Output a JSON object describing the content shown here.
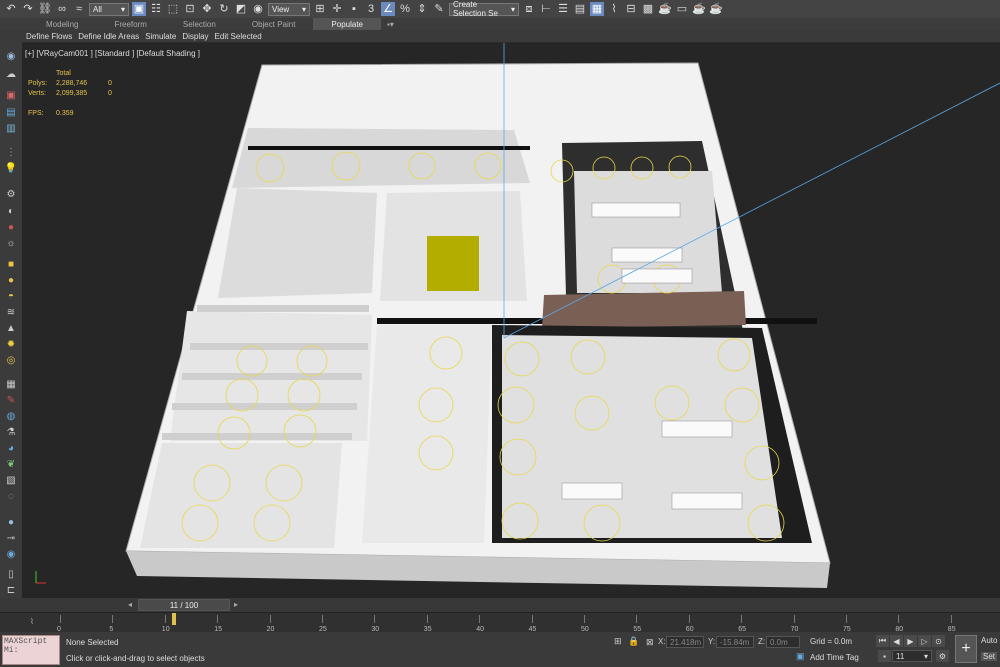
{
  "toolbar": {
    "filter_value": "All",
    "refcoord_value": "View",
    "selection_set_placeholder": "Create Selection Se",
    "left_icons": [
      "undo-icon",
      "redo-icon",
      "link-icon",
      "unlink-icon",
      "bind-spacewarp-icon"
    ],
    "mid_icons": [
      "select-object-icon",
      "select-region-icon",
      "window-crossing-icon",
      "select-move-icon",
      "select-rotate-icon",
      "select-scale-icon",
      "select-place-icon"
    ],
    "snap_icons": [
      "snap-3d-icon",
      "angle-snap-icon",
      "percent-snap-icon",
      "spinner-snap-icon"
    ],
    "right_icons": [
      "edit-named-sets-icon",
      "mirror-icon",
      "align-icon",
      "scene-explorer-icon",
      "layer-explorer-icon",
      "toggle-ribbon-icon",
      "curve-editor-icon",
      "schematic-view-icon",
      "material-editor-icon",
      "render-setup-icon",
      "rendered-frame-icon",
      "render-icon",
      "render-iterative-icon"
    ]
  },
  "ribbon": {
    "tabs": [
      "Modeling",
      "Freeform",
      "Selection",
      "Object Paint",
      "Populate"
    ],
    "active_tab": "Populate",
    "sub_items": [
      "Define Flows",
      "Define Idle Areas",
      "Simulate",
      "Display",
      "Edit Selected"
    ]
  },
  "viewport": {
    "label": "[+] [VRayCam001 ] [Standard ] [Default Shading ]",
    "stats": {
      "header": "Total",
      "polys_label": "Polys:",
      "polys_total": "2,288,746",
      "polys_sel": "0",
      "verts_label": "Verts:",
      "verts_total": "2,099,385",
      "verts_sel": "0",
      "fps_label": "FPS:",
      "fps_value": "0.359"
    }
  },
  "timeline": {
    "slider_label": "11 / 100",
    "current_frame": 11,
    "ticks": [
      "0",
      "5",
      "10",
      "15",
      "20",
      "25",
      "30",
      "35",
      "40",
      "45",
      "50",
      "55",
      "60",
      "65",
      "70",
      "75",
      "80",
      "85"
    ]
  },
  "status": {
    "maxscript_label": "MAXScript Mi:",
    "selection_status": "None Selected",
    "prompt": "Click or click-and-drag to select objects",
    "x_label": "X:",
    "x_value": "21.418m",
    "y_label": "Y:",
    "y_value": "-15.84m",
    "z_label": "Z:",
    "z_value": "0.0m",
    "grid": "Grid = 0.0m",
    "add_time_tag": "Add Time Tag",
    "frame_field": "11",
    "auto_label": "Auto",
    "set_label": "Set"
  },
  "colors": {
    "light_gizmo": "#e8d84a",
    "camera_line": "#5aa8e8",
    "yellow_object": "#b8b000",
    "active_tab": "#555555",
    "stats_text": "#e2c44a"
  }
}
